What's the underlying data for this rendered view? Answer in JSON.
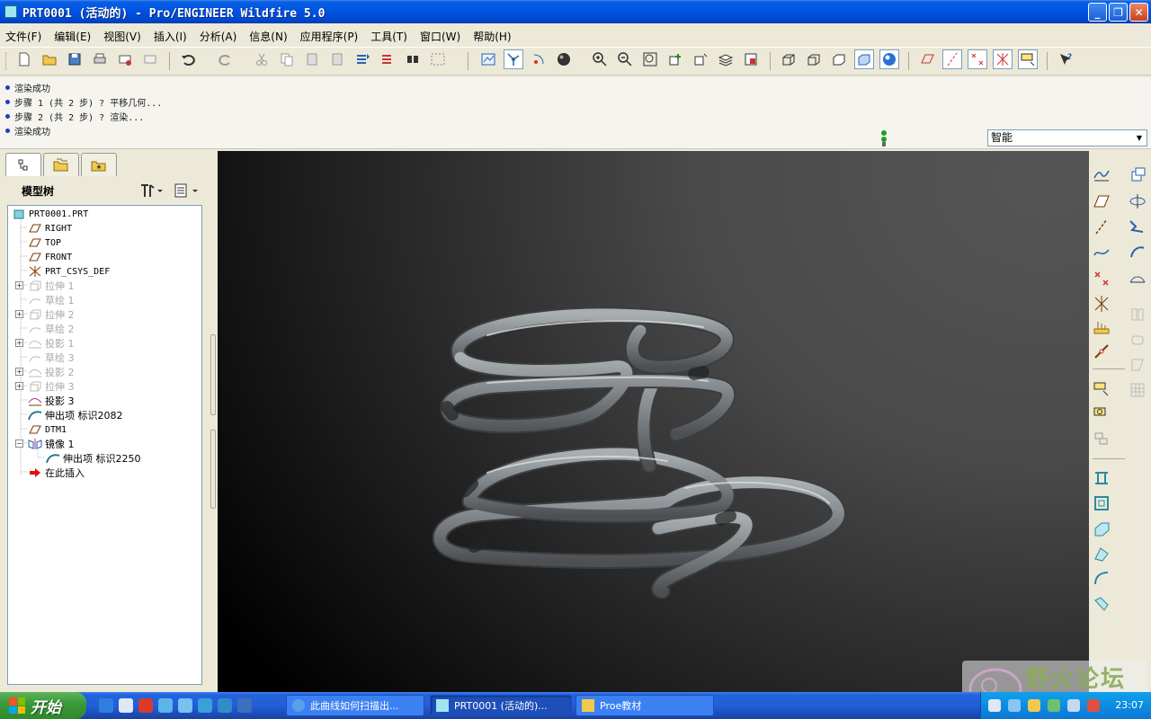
{
  "window": {
    "title": "PRT0001 (活动的) - Pro/ENGINEER Wildfire 5.0",
    "minimize": "_",
    "restore": "❐",
    "close": "✕"
  },
  "menu": [
    "文件(F)",
    "编辑(E)",
    "视图(V)",
    "插入(I)",
    "分析(A)",
    "信息(N)",
    "应用程序(P)",
    "工具(T)",
    "窗口(W)",
    "帮助(H)"
  ],
  "messages": [
    "渲染成功",
    "步骤 1 (共 2 步) ? 平移几何...",
    "步骤 2 (共 2 步) ? 渲染...",
    "渲染成功"
  ],
  "filter": {
    "selected": "智能"
  },
  "model_tree": {
    "title": "模型树",
    "items": [
      {
        "label": "PRT0001.PRT",
        "icon": "part-icon",
        "dim": false
      },
      {
        "label": "RIGHT",
        "icon": "datum-plane-icon",
        "dim": false
      },
      {
        "label": "TOP",
        "icon": "datum-plane-icon",
        "dim": false
      },
      {
        "label": "FRONT",
        "icon": "datum-plane-icon",
        "dim": false
      },
      {
        "label": "PRT_CSYS_DEF",
        "icon": "csys-icon",
        "dim": false
      },
      {
        "label": "拉伸 1",
        "icon": "extrude-icon",
        "dim": true
      },
      {
        "label": "草绘 1",
        "icon": "sketch-icon",
        "dim": true
      },
      {
        "label": "拉伸 2",
        "icon": "extrude-icon",
        "dim": true
      },
      {
        "label": "草绘 2",
        "icon": "sketch-icon",
        "dim": true
      },
      {
        "label": "投影 1",
        "icon": "projection-icon",
        "dim": true
      },
      {
        "label": "草绘 3",
        "icon": "sketch-icon",
        "dim": true
      },
      {
        "label": "投影 2",
        "icon": "projection-icon",
        "dim": true
      },
      {
        "label": "拉伸 3",
        "icon": "extrude-icon",
        "dim": true
      },
      {
        "label": "投影 3",
        "icon": "projection-icon",
        "dim": false
      },
      {
        "label": "伸出项 标识2082",
        "icon": "protrusion-icon",
        "dim": false
      },
      {
        "label": "DTM1",
        "icon": "datum-plane-icon",
        "dim": false
      },
      {
        "label": "镜像 1",
        "icon": "mirror-icon",
        "dim": false
      },
      {
        "label": "伸出项 标识2250",
        "icon": "protrusion-icon",
        "dim": false
      },
      {
        "label": "在此插入",
        "icon": "insert-here-icon",
        "dim": false
      }
    ]
  },
  "taskbar": {
    "start": "开始",
    "tasks": [
      "此曲线如何扫描出...",
      "PRT0001 (活动的)...",
      "Proe教材"
    ],
    "time": "23:07"
  },
  "watermark": "野火论坛",
  "colors": {
    "accent": "#0055e5",
    "tube": "#8a8f92",
    "viewport_dark": "#000000"
  }
}
